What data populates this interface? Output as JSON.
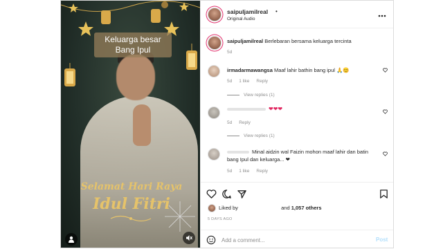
{
  "media": {
    "caption_top_line1": "Keluarga besar",
    "caption_top_line2": "Bang Ipul",
    "greeting_line1": "Selamat Hari Raya",
    "greeting_line2": "Idul Fitri",
    "gold_color": "#e6c36a"
  },
  "header": {
    "username": "saipuljamilreal",
    "dot": "•",
    "subtitle": "Original Audio",
    "more": "•••"
  },
  "post": {
    "username": "saipuljamilreal",
    "caption": "Berlebaran bersama keluarga tercinta",
    "age": "5d"
  },
  "comments": [
    {
      "username": "irmadarmawangsa",
      "text": "Maaf lahir bathin bang ipul 🙏😊",
      "age": "5d",
      "likes": "1 like",
      "reply": "Reply",
      "view_replies": "View replies (1)"
    },
    {
      "text": "❤❤❤",
      "age": "5d",
      "reply": "Reply",
      "view_replies": "View replies (1)"
    },
    {
      "text_line1": "Minal aidzin wal Faizin mohon maaf lahir dan batin",
      "text_line2": "bang Ipul dan keluarga... ❤",
      "age": "5d",
      "likes": "1 like",
      "reply": "Reply"
    }
  ],
  "likes": {
    "prefix": "Liked by",
    "suffix": "and",
    "count": "1,057 others"
  },
  "date": "5 DAYS AGO",
  "add_comment": {
    "placeholder": "Add a comment...",
    "post_label": "Post"
  },
  "colors": {
    "heart_red": "#e0245e",
    "post_disabled": "#b2dffc",
    "secondary": "#8e8e8e"
  }
}
